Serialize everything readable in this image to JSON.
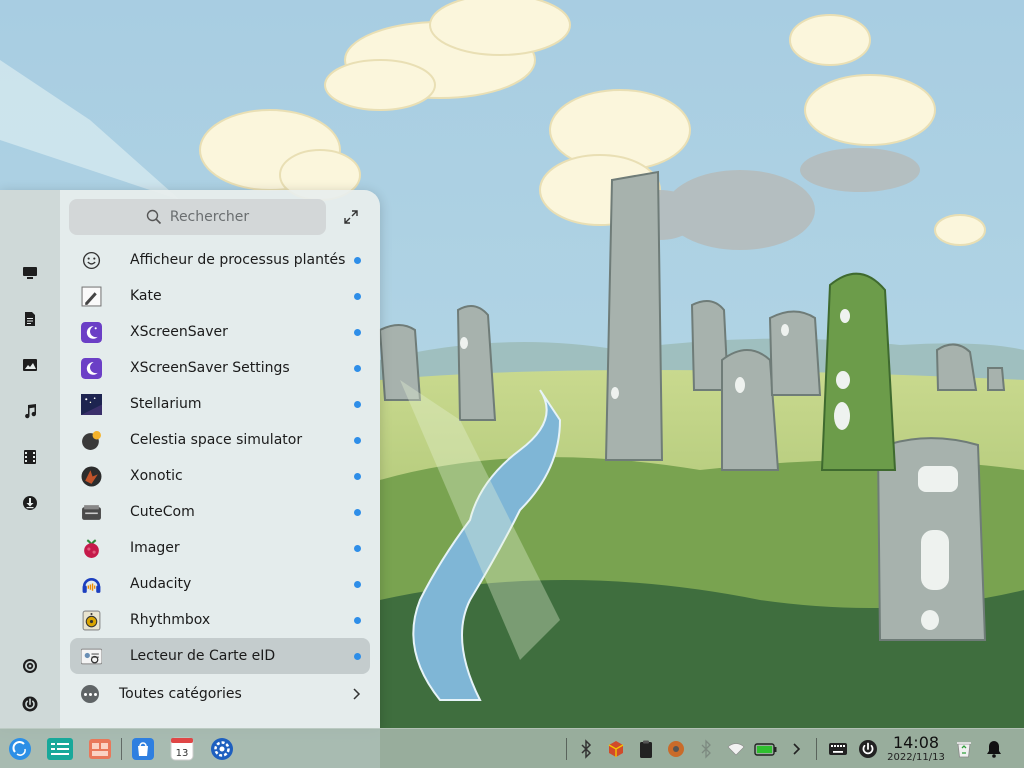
{
  "search": {
    "placeholder": "Rechercher"
  },
  "apps": [
    {
      "name": "Afficheur de processus plantés",
      "icon": "smiley-face-icon",
      "new": true
    },
    {
      "name": "Kate",
      "icon": "kate-editor-icon",
      "new": true
    },
    {
      "name": "XScreenSaver",
      "icon": "xscreensaver-icon",
      "new": true
    },
    {
      "name": "XScreenSaver Settings",
      "icon": "xscreensaver-settings-icon",
      "new": true
    },
    {
      "name": "Stellarium",
      "icon": "stellarium-icon",
      "new": true
    },
    {
      "name": "Celestia space simulator",
      "icon": "celestia-icon",
      "new": true
    },
    {
      "name": "Xonotic",
      "icon": "xonotic-icon",
      "new": true
    },
    {
      "name": "CuteCom",
      "icon": "cutecom-icon",
      "new": true
    },
    {
      "name": "Imager",
      "icon": "raspberry-pi-imager-icon",
      "new": true
    },
    {
      "name": "Audacity",
      "icon": "audacity-icon",
      "new": true
    },
    {
      "name": "Rhythmbox",
      "icon": "rhythmbox-icon",
      "new": true
    },
    {
      "name": "Lecteur de Carte eID",
      "icon": "eid-card-reader-icon",
      "new": true,
      "selected": true
    }
  ],
  "categories_label": "Toutes catégories",
  "sidebar": [
    "computer-icon",
    "documents-icon",
    "pictures-icon",
    "music-icon",
    "videos-icon",
    "downloads-icon",
    "settings-icon",
    "power-icon"
  ],
  "taskbar": {
    "pinned": [
      "deepin-launcher-icon",
      "multitasking-view-icon",
      "file-manager-icon",
      "app-store-icon",
      "calendar-icon",
      "control-center-icon"
    ],
    "calendar_day": "13",
    "tray": [
      "bluetooth-icon",
      "package-icon",
      "clipboard-icon",
      "drive-icon",
      "bluetooth-off-icon",
      "wifi-icon",
      "battery-icon",
      "expand-tray-icon",
      "keyboard-icon",
      "power-icon",
      "trash-icon",
      "notification-bell-icon"
    ],
    "time": "14:08",
    "date": "2022/11/13"
  },
  "colors": {
    "accent": "#2e8ee8",
    "launcher_bg": "#e8eeed",
    "taskbar_bg": "#a5b6aa"
  }
}
